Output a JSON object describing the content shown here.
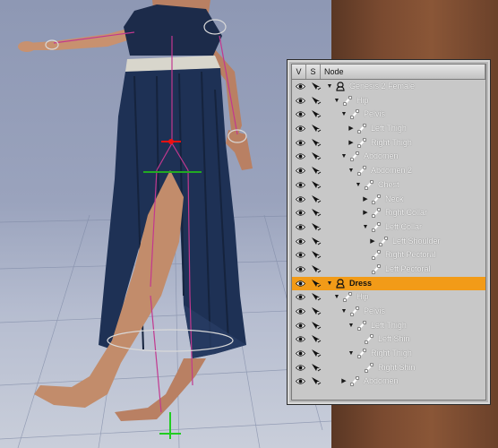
{
  "scene_panel": {
    "columns": {
      "visible": "V",
      "selectable": "S",
      "node": "Node"
    },
    "nodes": [
      {
        "label": "Genesis 2 Female",
        "depth": 0,
        "expander": "open",
        "icon": "figure-icon",
        "selected": false
      },
      {
        "label": "Hip",
        "depth": 1,
        "expander": "open",
        "icon": "bone-icon",
        "selected": false
      },
      {
        "label": "Pelvis",
        "depth": 2,
        "expander": "open",
        "icon": "bone-icon",
        "selected": false
      },
      {
        "label": "Left Thigh",
        "depth": 3,
        "expander": "closed",
        "icon": "bone-icon",
        "selected": false
      },
      {
        "label": "Right Thigh",
        "depth": 3,
        "expander": "closed",
        "icon": "bone-icon",
        "selected": false
      },
      {
        "label": "Abdomen",
        "depth": 2,
        "expander": "open",
        "icon": "bone-icon",
        "selected": false
      },
      {
        "label": "Abdomen 2",
        "depth": 3,
        "expander": "open",
        "icon": "bone-icon",
        "selected": false
      },
      {
        "label": "Chest",
        "depth": 4,
        "expander": "open",
        "icon": "bone-icon",
        "selected": false
      },
      {
        "label": "Neck",
        "depth": 5,
        "expander": "closed",
        "icon": "bone-icon",
        "selected": false
      },
      {
        "label": "Right Collar",
        "depth": 5,
        "expander": "closed",
        "icon": "bone-icon",
        "selected": false
      },
      {
        "label": "Left Collar",
        "depth": 5,
        "expander": "open",
        "icon": "bone-icon",
        "selected": false
      },
      {
        "label": "Left Shoulder",
        "depth": 6,
        "expander": "closed",
        "icon": "bone-icon",
        "selected": false
      },
      {
        "label": "Right Pectoral",
        "depth": 5,
        "expander": "none",
        "icon": "bone-icon",
        "selected": false
      },
      {
        "label": "Left Pectoral",
        "depth": 5,
        "expander": "none",
        "icon": "bone-icon",
        "selected": false
      },
      {
        "label": "Dress",
        "depth": 0,
        "expander": "open",
        "icon": "figure-icon",
        "selected": true
      },
      {
        "label": "Hip",
        "depth": 1,
        "expander": "open",
        "icon": "bone-icon",
        "selected": false
      },
      {
        "label": "Pelvis",
        "depth": 2,
        "expander": "open",
        "icon": "bone-icon",
        "selected": false
      },
      {
        "label": "Left Thigh",
        "depth": 3,
        "expander": "open",
        "icon": "bone-icon",
        "selected": false
      },
      {
        "label": "Left Shin",
        "depth": 4,
        "expander": "none",
        "icon": "bone-icon",
        "selected": false
      },
      {
        "label": "Right Thigh",
        "depth": 3,
        "expander": "open",
        "icon": "bone-icon",
        "selected": false
      },
      {
        "label": "Right Shin",
        "depth": 4,
        "expander": "none",
        "icon": "bone-icon",
        "selected": false
      },
      {
        "label": "Abdomen",
        "depth": 2,
        "expander": "closed",
        "icon": "bone-icon",
        "selected": false
      }
    ],
    "row_icons": {
      "visible": "eye-icon",
      "selectable": "select-arrow-icon"
    },
    "colors": {
      "selected_row": "#f29b18",
      "panel_bg": "#c8c8c8"
    }
  },
  "viewport": {
    "figure": "Genesis 2 Female",
    "clothing": "Dress",
    "colors": {
      "dress": "#1d2f4f",
      "skin": "#c89070",
      "bone_overlay": "#c2388f",
      "wall": "#7a4a30",
      "background": "#9aa3b6"
    }
  }
}
